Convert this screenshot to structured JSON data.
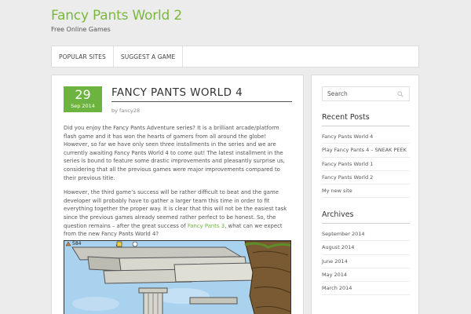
{
  "site": {
    "title": "Fancy Pants World 2",
    "tagline": "Free Online Games"
  },
  "nav": {
    "items": [
      "POPULAR SITES",
      "SUGGEST A GAME"
    ]
  },
  "post": {
    "date_day": "29",
    "date_month_year": "Sep 2014",
    "title": "FANCY PANTS WORLD 4",
    "byline": "by fancy28",
    "paragraph1": "Did you enjoy the Fancy Pants Adventure series? It is a brilliant arcade/platform flash game  and it has won the hearts of gamers from all around the globe! However, so far we have only seen three installments in the series and we are currently awaiting Fancy Pants World 4 to come out! The latest installment in the series is bound to feature some drastic improvements and pleasantly surprise us, considering that all the previous games were major improvements compared to their previous title.",
    "paragraph2_before": "However, the third game’s success will be rather difficult to beat and the game developer will probably have to gather a larger team this time in order to fit everything together the proper way. It is clear that this will not be the easiest task since the previous games already seemed rather perfect to be honest. So, the question remains – after the great success of ",
    "paragraph2_link": "Fancy Pants 3",
    "paragraph2_after": ", what can we expect from the new Fancy Pants World 4?",
    "screenshot_hud": "584"
  },
  "sidebar": {
    "search_placeholder": "Search",
    "recent_title": "Recent Posts",
    "recent_posts": [
      "Fancy Pants World 4",
      "Play Fancy Pants 4 – SNEAK PEEK",
      "Fancy Pants World 1",
      "Fancy Pants World 2",
      "My new site"
    ],
    "archives_title": "Archives",
    "archives": [
      "September 2014",
      "August 2014",
      "June 2014",
      "May 2014",
      "March 2014"
    ]
  },
  "colors": {
    "accent": "#6db33f",
    "title_green": "#7ab83a",
    "background": "#ececec"
  }
}
